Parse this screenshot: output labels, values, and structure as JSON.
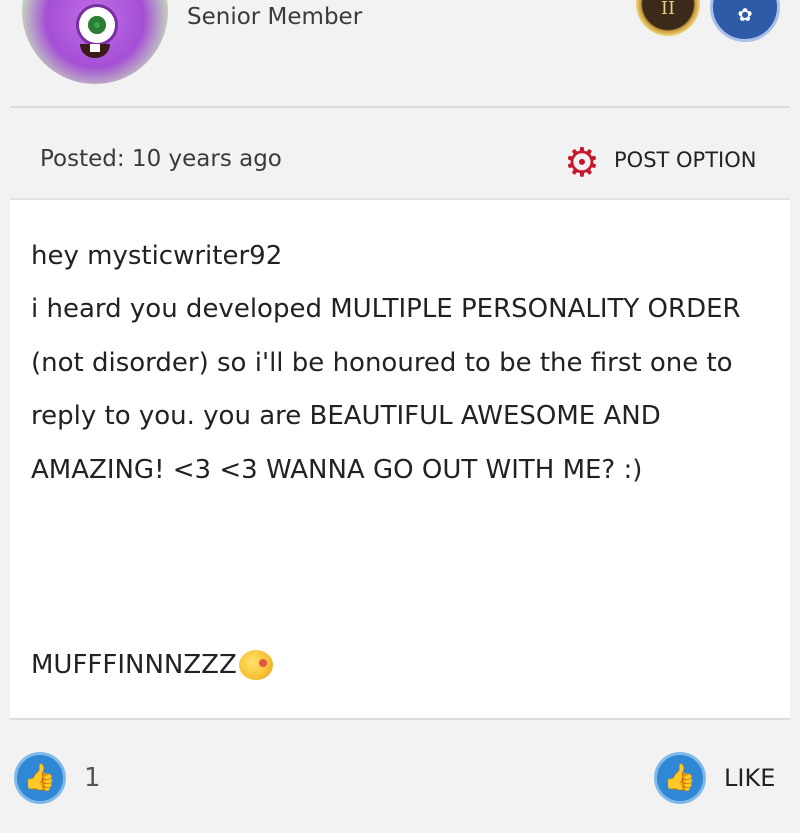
{
  "author": {
    "role": "Senior Member",
    "badges": [
      {
        "name": "gold-rank-badge",
        "glyph": "II",
        "color": "#c89a3a"
      },
      {
        "name": "community-badge",
        "glyph": "✿",
        "color": "#2e5aa8"
      }
    ]
  },
  "post": {
    "posted_label": "Posted: 10 years ago",
    "option_label": "POST OPTION",
    "greeting": "hey mysticwriter92",
    "message": "i heard you developed MULTIPLE PERSONALITY ORDER (not disorder) so i'll be honoured to be the first one to reply to you. you are BEAUTIFUL AWESOME AND AMAZING! <3 <3 WANNA GO OUT WITH ME? :)",
    "signoff": "MUFFFINNNZZZ",
    "signoff_emoji": "kissing-face-emoji"
  },
  "footer": {
    "like_count": "1",
    "like_label": "LIKE"
  },
  "colors": {
    "accent_red": "#c8162d",
    "like_blue": "#2f88d6",
    "background": "#f2f2f2"
  }
}
